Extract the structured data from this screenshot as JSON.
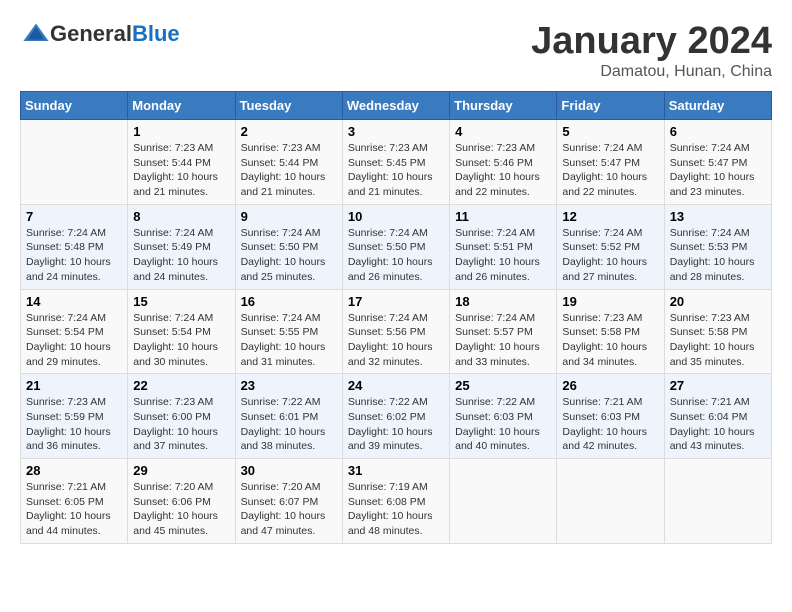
{
  "header": {
    "logo_general": "General",
    "logo_blue": "Blue",
    "month_title": "January 2024",
    "location": "Damatou, Hunan, China"
  },
  "weekdays": [
    "Sunday",
    "Monday",
    "Tuesday",
    "Wednesday",
    "Thursday",
    "Friday",
    "Saturday"
  ],
  "weeks": [
    [
      {
        "day": "",
        "info": ""
      },
      {
        "day": "1",
        "info": "Sunrise: 7:23 AM\nSunset: 5:44 PM\nDaylight: 10 hours\nand 21 minutes."
      },
      {
        "day": "2",
        "info": "Sunrise: 7:23 AM\nSunset: 5:44 PM\nDaylight: 10 hours\nand 21 minutes."
      },
      {
        "day": "3",
        "info": "Sunrise: 7:23 AM\nSunset: 5:45 PM\nDaylight: 10 hours\nand 21 minutes."
      },
      {
        "day": "4",
        "info": "Sunrise: 7:23 AM\nSunset: 5:46 PM\nDaylight: 10 hours\nand 22 minutes."
      },
      {
        "day": "5",
        "info": "Sunrise: 7:24 AM\nSunset: 5:47 PM\nDaylight: 10 hours\nand 22 minutes."
      },
      {
        "day": "6",
        "info": "Sunrise: 7:24 AM\nSunset: 5:47 PM\nDaylight: 10 hours\nand 23 minutes."
      }
    ],
    [
      {
        "day": "7",
        "info": "Sunrise: 7:24 AM\nSunset: 5:48 PM\nDaylight: 10 hours\nand 24 minutes."
      },
      {
        "day": "8",
        "info": "Sunrise: 7:24 AM\nSunset: 5:49 PM\nDaylight: 10 hours\nand 24 minutes."
      },
      {
        "day": "9",
        "info": "Sunrise: 7:24 AM\nSunset: 5:50 PM\nDaylight: 10 hours\nand 25 minutes."
      },
      {
        "day": "10",
        "info": "Sunrise: 7:24 AM\nSunset: 5:50 PM\nDaylight: 10 hours\nand 26 minutes."
      },
      {
        "day": "11",
        "info": "Sunrise: 7:24 AM\nSunset: 5:51 PM\nDaylight: 10 hours\nand 26 minutes."
      },
      {
        "day": "12",
        "info": "Sunrise: 7:24 AM\nSunset: 5:52 PM\nDaylight: 10 hours\nand 27 minutes."
      },
      {
        "day": "13",
        "info": "Sunrise: 7:24 AM\nSunset: 5:53 PM\nDaylight: 10 hours\nand 28 minutes."
      }
    ],
    [
      {
        "day": "14",
        "info": "Sunrise: 7:24 AM\nSunset: 5:54 PM\nDaylight: 10 hours\nand 29 minutes."
      },
      {
        "day": "15",
        "info": "Sunrise: 7:24 AM\nSunset: 5:54 PM\nDaylight: 10 hours\nand 30 minutes."
      },
      {
        "day": "16",
        "info": "Sunrise: 7:24 AM\nSunset: 5:55 PM\nDaylight: 10 hours\nand 31 minutes."
      },
      {
        "day": "17",
        "info": "Sunrise: 7:24 AM\nSunset: 5:56 PM\nDaylight: 10 hours\nand 32 minutes."
      },
      {
        "day": "18",
        "info": "Sunrise: 7:24 AM\nSunset: 5:57 PM\nDaylight: 10 hours\nand 33 minutes."
      },
      {
        "day": "19",
        "info": "Sunrise: 7:23 AM\nSunset: 5:58 PM\nDaylight: 10 hours\nand 34 minutes."
      },
      {
        "day": "20",
        "info": "Sunrise: 7:23 AM\nSunset: 5:58 PM\nDaylight: 10 hours\nand 35 minutes."
      }
    ],
    [
      {
        "day": "21",
        "info": "Sunrise: 7:23 AM\nSunset: 5:59 PM\nDaylight: 10 hours\nand 36 minutes."
      },
      {
        "day": "22",
        "info": "Sunrise: 7:23 AM\nSunset: 6:00 PM\nDaylight: 10 hours\nand 37 minutes."
      },
      {
        "day": "23",
        "info": "Sunrise: 7:22 AM\nSunset: 6:01 PM\nDaylight: 10 hours\nand 38 minutes."
      },
      {
        "day": "24",
        "info": "Sunrise: 7:22 AM\nSunset: 6:02 PM\nDaylight: 10 hours\nand 39 minutes."
      },
      {
        "day": "25",
        "info": "Sunrise: 7:22 AM\nSunset: 6:03 PM\nDaylight: 10 hours\nand 40 minutes."
      },
      {
        "day": "26",
        "info": "Sunrise: 7:21 AM\nSunset: 6:03 PM\nDaylight: 10 hours\nand 42 minutes."
      },
      {
        "day": "27",
        "info": "Sunrise: 7:21 AM\nSunset: 6:04 PM\nDaylight: 10 hours\nand 43 minutes."
      }
    ],
    [
      {
        "day": "28",
        "info": "Sunrise: 7:21 AM\nSunset: 6:05 PM\nDaylight: 10 hours\nand 44 minutes."
      },
      {
        "day": "29",
        "info": "Sunrise: 7:20 AM\nSunset: 6:06 PM\nDaylight: 10 hours\nand 45 minutes."
      },
      {
        "day": "30",
        "info": "Sunrise: 7:20 AM\nSunset: 6:07 PM\nDaylight: 10 hours\nand 47 minutes."
      },
      {
        "day": "31",
        "info": "Sunrise: 7:19 AM\nSunset: 6:08 PM\nDaylight: 10 hours\nand 48 minutes."
      },
      {
        "day": "",
        "info": ""
      },
      {
        "day": "",
        "info": ""
      },
      {
        "day": "",
        "info": ""
      }
    ]
  ]
}
